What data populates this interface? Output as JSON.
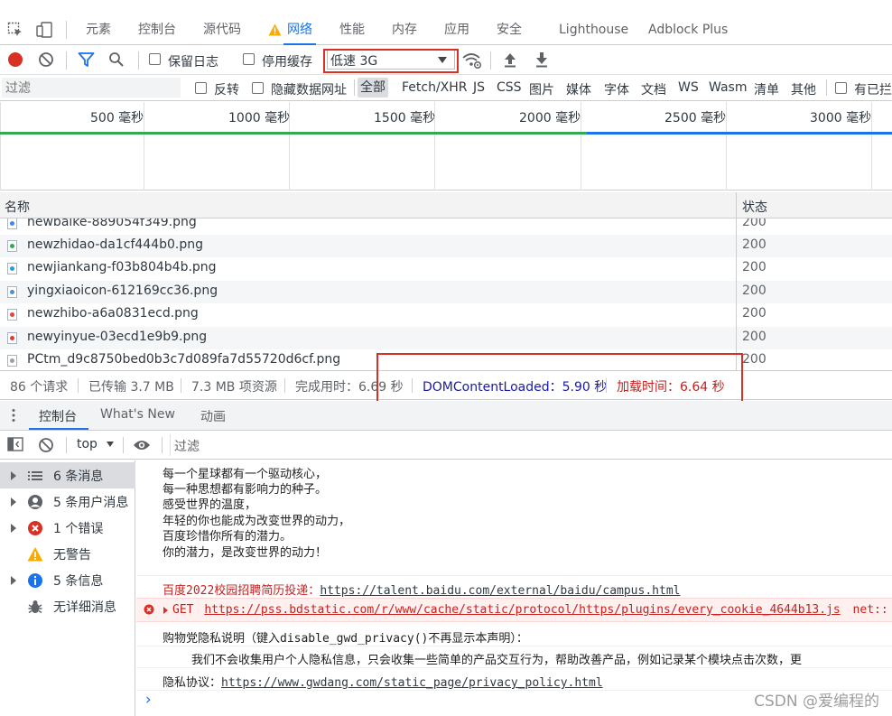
{
  "top_tabs": [
    "元素",
    "控制台",
    "源代码",
    "网络",
    "性能",
    "内存",
    "应用",
    "安全",
    "Lighthouse",
    "Adblock Plus"
  ],
  "network_toolbar": {
    "preserve_log": "保留日志",
    "disable_cache": "停用缓存",
    "throttle": "低速 3G"
  },
  "filter": {
    "placeholder": "过滤",
    "invert": "反转",
    "hide_data_urls": "隐藏数据网址",
    "types": [
      "全部",
      "Fetch/XHR",
      "JS",
      "CSS",
      "图片",
      "媒体",
      "字体",
      "文档",
      "WS",
      "Wasm",
      "清单",
      "其他"
    ],
    "blocked_cookies": "有已拦"
  },
  "timeline": {
    "labels": [
      "500 毫秒",
      "1000 毫秒",
      "1500 毫秒",
      "2000 毫秒",
      "2500 毫秒",
      "3000 毫秒"
    ]
  },
  "table": {
    "headers": {
      "name": "名称",
      "status": "状态"
    },
    "rows": [
      {
        "name": "newbaike-889054f349.png",
        "status": "200",
        "color": "#4285f4"
      },
      {
        "name": "newzhidao-da1cf444b0.png",
        "status": "200",
        "color": "#34a853"
      },
      {
        "name": "newjiankang-f03b804b4b.png",
        "status": "200",
        "color": "#1ea0d8"
      },
      {
        "name": "yingxiaoicon-612169cc36.png",
        "status": "200",
        "color": "#4a90d9"
      },
      {
        "name": "newzhibo-a6a0831ecd.png",
        "status": "200",
        "color": "#ea4335"
      },
      {
        "name": "newyinyue-03ecd1e9b9.png",
        "status": "200",
        "color": "#e53935"
      },
      {
        "name": "PCtm_d9c8750bed0b3c7d089fa7d55720d6cf.png",
        "status": "200",
        "color": "#9e9e9e"
      }
    ]
  },
  "summary": {
    "requests": "86 个请求",
    "transferred": "已传输 3.7 MB",
    "resources": "7.3 MB 项资源",
    "finish": "完成用时：6.69 秒",
    "dcl": "DOMContentLoaded：5.90 秒",
    "load": "加载时间：6.64 秒",
    "dcl_color": "#1a1aa6",
    "load_color": "#c5221f"
  },
  "drawer_tabs": [
    "控制台",
    "What's New",
    "动画"
  ],
  "console_toolbar": {
    "context": "top",
    "filter_placeholder": "过滤"
  },
  "sidebar": [
    {
      "label": "6 条消息",
      "icon": "list-icon"
    },
    {
      "label": "5 条用户消息",
      "icon": "user-icon"
    },
    {
      "label": "1 个错误",
      "icon": "error-icon"
    },
    {
      "label": "无警告",
      "icon": "warning-icon"
    },
    {
      "label": "5 条信息",
      "icon": "info-icon"
    },
    {
      "label": "无详细消息",
      "icon": "bug-icon"
    }
  ],
  "console": {
    "poem": [
      "每一个星球都有一个驱动核心，",
      "每一种思想都有影响力的种子。",
      "感受世界的温度，",
      "年轻的你也能成为改变世界的动力，",
      "百度珍惜你所有的潜力。",
      "你的潜力，是改变世界的动力！"
    ],
    "recruit_prefix": "百度2022校园招聘简历投递：",
    "recruit_url": "https://talent.baidu.com/external/baidu/campus.html",
    "error_method": "GET",
    "error_url": "https://pss.bdstatic.com/r/www/cache/static/protocol/https/plugins/every_cookie_4644b13.js",
    "error_suffix": "net::",
    "privacy_title": "购物党隐私说明（键入disable_gwd_privacy()不再显示本声明）：",
    "privacy_body": "我们不会收集用户个人隐私信息，只会收集一些简单的产品交互行为，帮助改善产品，例如记录某个模块点击次数，更",
    "privacy_label": "隐私协议：",
    "privacy_url": "https://www.gwdang.com/static_page/privacy_policy.html",
    "prompt": "›"
  },
  "watermark": "CSDN @爱编程的"
}
